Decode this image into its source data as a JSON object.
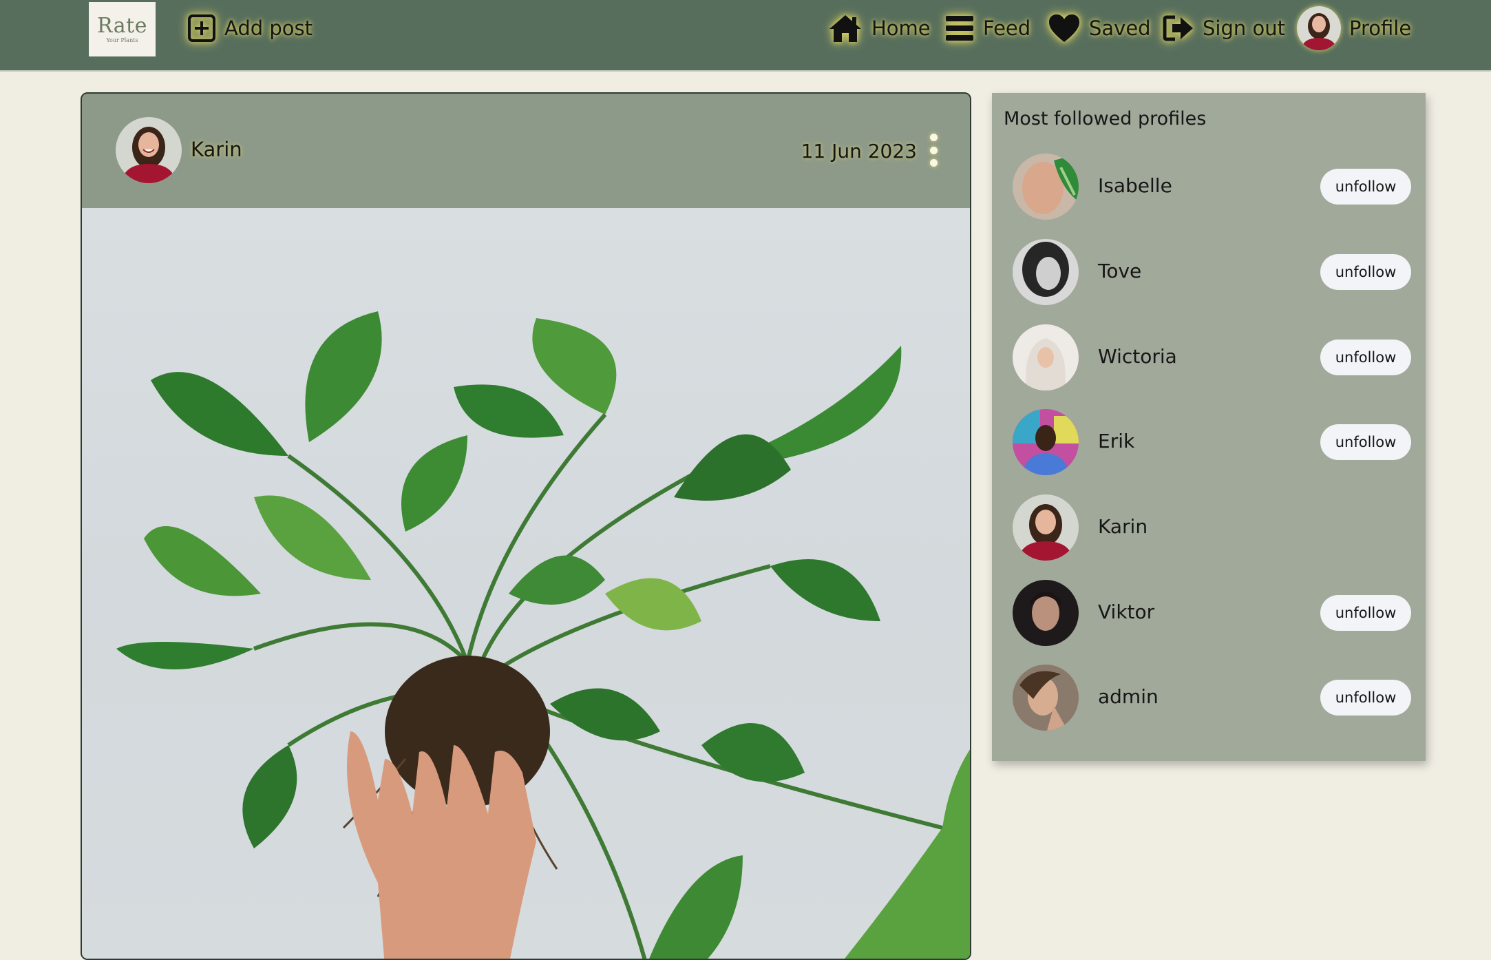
{
  "brand": {
    "title": "Rate",
    "subtitle": "Your Plants"
  },
  "nav": {
    "add_post": "Add post",
    "home": "Home",
    "feed": "Feed",
    "saved": "Saved",
    "sign_out": "Sign out",
    "profile": "Profile"
  },
  "post": {
    "author": "Karin",
    "date": "11 Jun 2023",
    "image": "potted-pothos-plant-in-hand"
  },
  "sidebar": {
    "title": "Most followed profiles",
    "button_label": "unfollow",
    "profiles": [
      {
        "name": "Isabelle",
        "button": "unfollow"
      },
      {
        "name": "Tove",
        "button": "unfollow"
      },
      {
        "name": "Wictoria",
        "button": "unfollow"
      },
      {
        "name": "Erik",
        "button": "unfollow"
      },
      {
        "name": "Karin",
        "button": ""
      },
      {
        "name": "Viktor",
        "button": "unfollow"
      },
      {
        "name": "admin",
        "button": "unfollow"
      }
    ]
  },
  "colors": {
    "navbar": "#576e5d",
    "page_background": "#f0ede3",
    "post_header": "#8e9a89",
    "sidebar": "#a1a99a",
    "glow": "#d8d36a"
  }
}
